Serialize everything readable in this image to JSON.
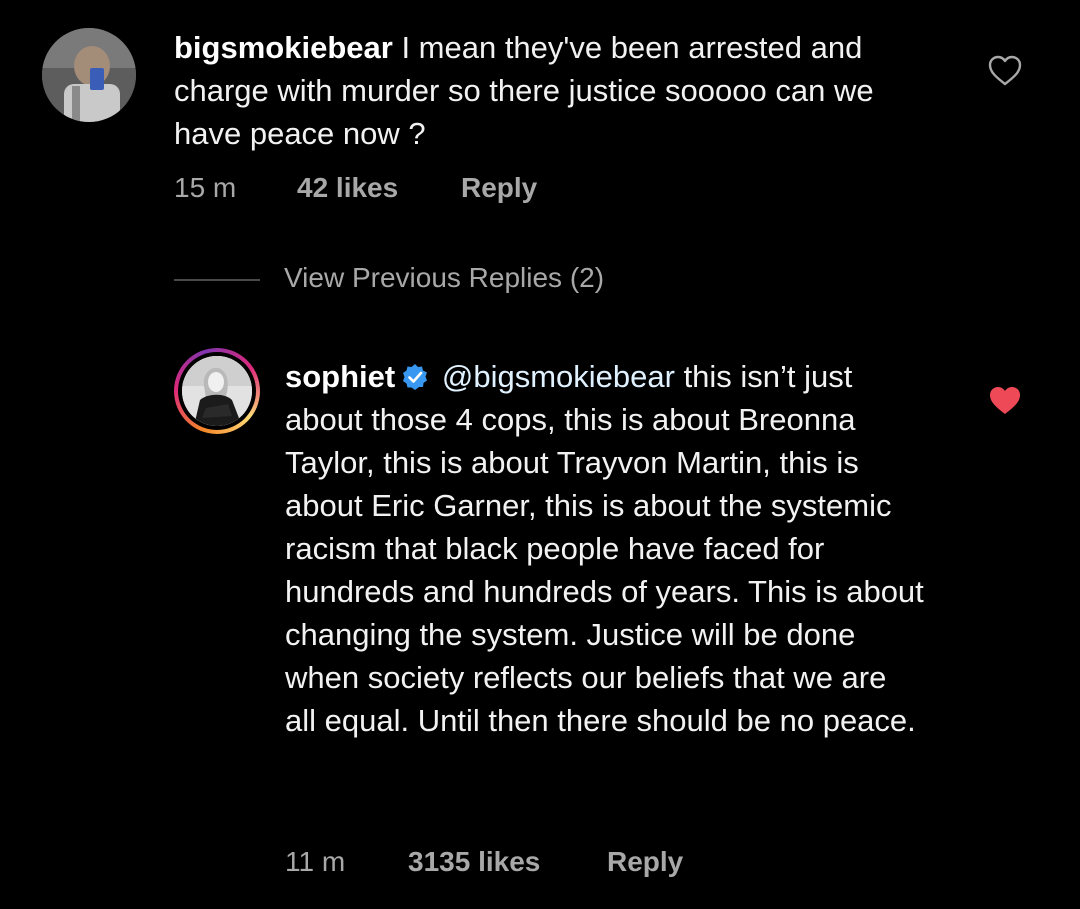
{
  "comments": [
    {
      "username": "bigsmokiebear",
      "text": "I mean they've been arrested and charge with murder so there justice sooooo can we have peace now ?",
      "time": "15 m",
      "likes": "42 likes",
      "reply_label": "Reply",
      "liked": false
    }
  ],
  "view_previous": {
    "label": "View Previous Replies (2)"
  },
  "reply": {
    "username": "sophiet",
    "verified": true,
    "mention": "@bigsmokiebear",
    "text": "this isn’t just about those 4 cops, this is about Breonna Taylor, this is about Trayvon Martin, this is about Eric Garner, this is about the systemic racism that black people have faced for hundreds and hundreds of years. This is about changing the system. Justice will be done when society reflects our beliefs that we are all equal. Until then there should be no peace.",
    "time": "11 m",
    "likes": "3135 likes",
    "reply_label": "Reply",
    "liked": true
  },
  "colors": {
    "background": "#000000",
    "text": "#f2f2f2",
    "meta": "#a8a8a8",
    "like_red": "#ed4956",
    "verified_blue": "#3897f0"
  },
  "icons": {
    "like_outline": "heart-outline-icon",
    "like_filled": "heart-filled-icon",
    "verified": "verified-badge-icon"
  }
}
